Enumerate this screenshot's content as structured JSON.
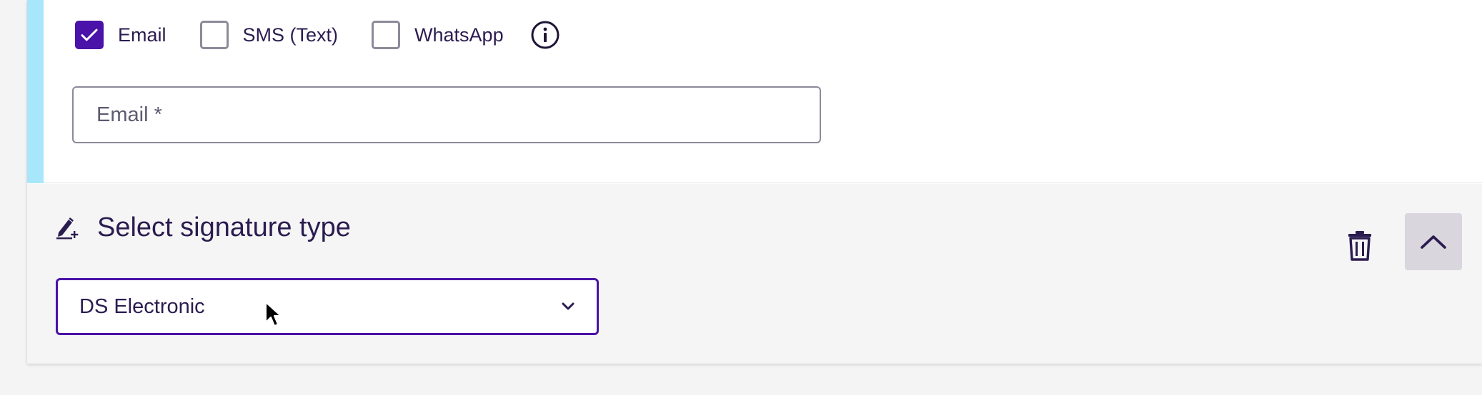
{
  "recipient": {
    "channels": [
      {
        "label": "Email",
        "checked": true
      },
      {
        "label": "SMS (Text)",
        "checked": false
      },
      {
        "label": "WhatsApp",
        "checked": false
      }
    ],
    "info_icon": "info-circle-icon",
    "email_field": {
      "placeholder": "Email *",
      "value": ""
    }
  },
  "signature": {
    "title": "Select signature type",
    "title_icon": "signature-pen-icon",
    "delete_icon": "trash-icon",
    "collapse_icon": "chevron-up-icon",
    "select": {
      "value": "DS Electronic",
      "icon": "chevron-down-icon"
    }
  },
  "colors": {
    "accent_bar": "#a8e6fb",
    "primary": "#4a12a8",
    "text": "#2b1c50",
    "section_bg": "#f5f5f5",
    "collapse_bg": "#d9d6dd"
  }
}
